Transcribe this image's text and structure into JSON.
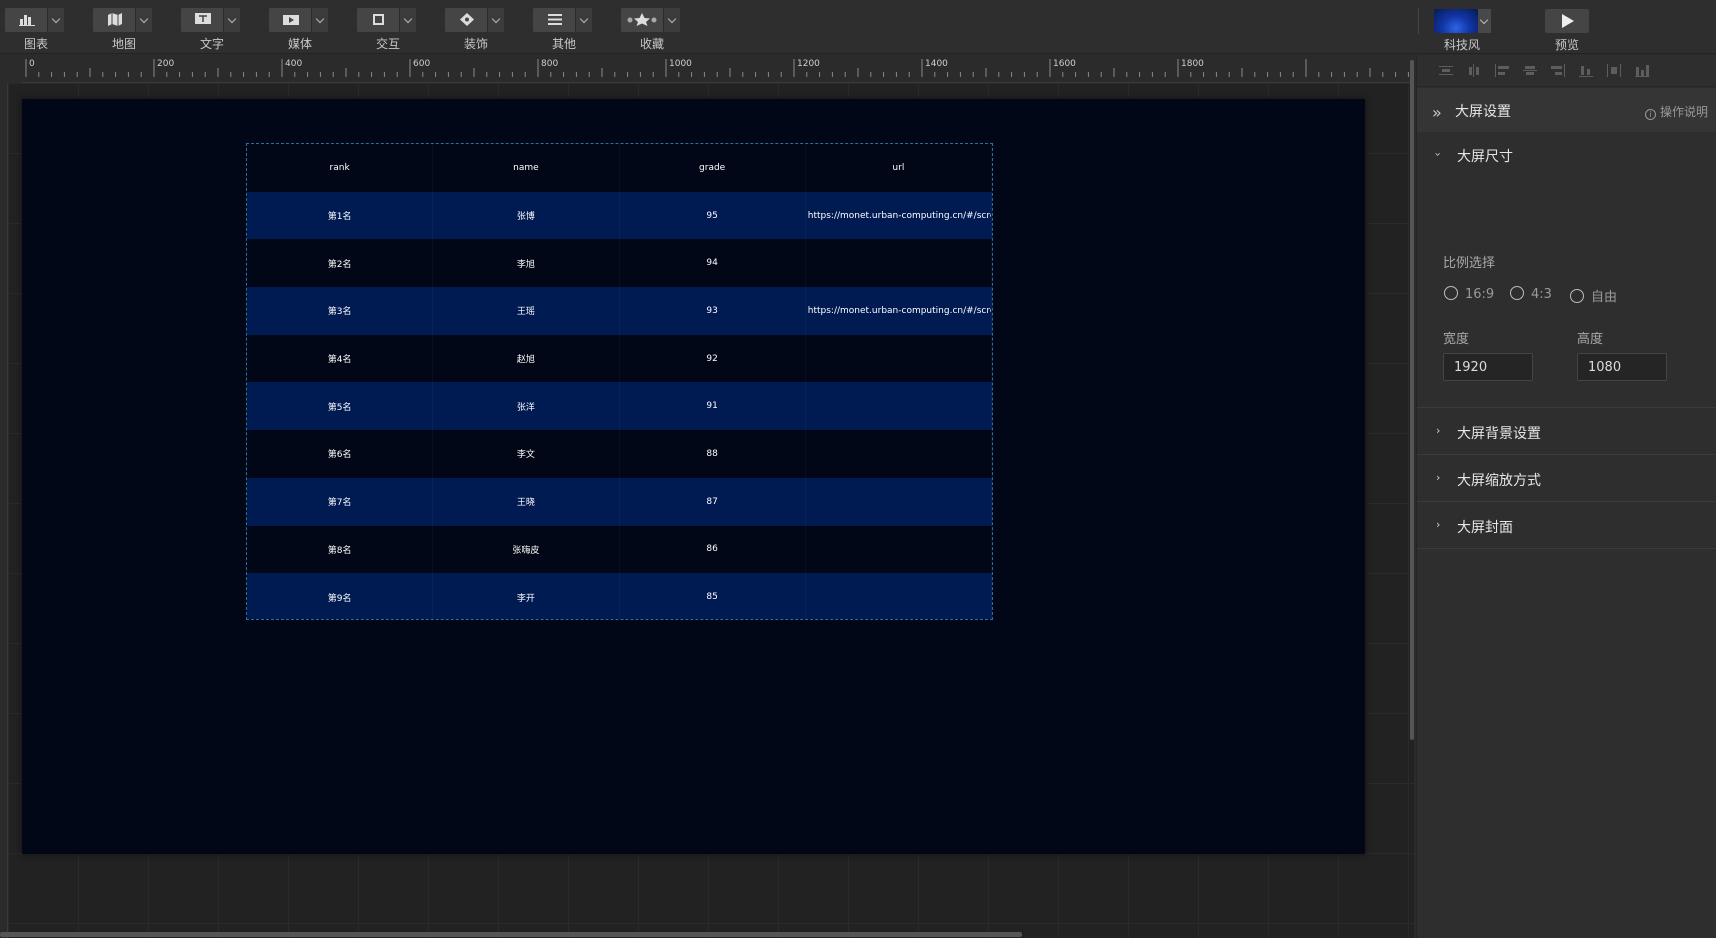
{
  "toolbar": {
    "tools": [
      {
        "label": "图表",
        "icon": "chart-icon"
      },
      {
        "label": "地图",
        "icon": "map-icon"
      },
      {
        "label": "文字",
        "icon": "text-icon"
      },
      {
        "label": "媒体",
        "icon": "media-icon"
      },
      {
        "label": "交互",
        "icon": "interaction-icon"
      },
      {
        "label": "装饰",
        "icon": "decoration-icon"
      },
      {
        "label": "其他",
        "icon": "other-icon"
      },
      {
        "label": "收藏",
        "icon": "favorites-icon"
      }
    ],
    "theme_label": "科技风",
    "preview_label": "预览"
  },
  "ruler": {
    "ticks": [
      "0",
      "200",
      "400",
      "600",
      "800",
      "1000",
      "1200",
      "1400",
      "1600",
      "1800"
    ]
  },
  "table": {
    "headers": [
      "rank",
      "name",
      "grade",
      "url"
    ],
    "rows": [
      [
        "第1名",
        "张博",
        "95",
        "https://monet.urban-computing.cn/#/screen?key="
      ],
      [
        "第2名",
        "李旭",
        "94",
        ""
      ],
      [
        "第3名",
        "王瑶",
        "93",
        "https://monet.urban-computing.cn/#/screen?key="
      ],
      [
        "第4名",
        "赵旭",
        "92",
        ""
      ],
      [
        "第5名",
        "张洋",
        "91",
        ""
      ],
      [
        "第6名",
        "李文",
        "88",
        ""
      ],
      [
        "第7名",
        "王晓",
        "87",
        ""
      ],
      [
        "第8名",
        "张嗨皮",
        "86",
        ""
      ],
      [
        "第9名",
        "李开",
        "85",
        ""
      ]
    ],
    "row_color_alt": "#001a52",
    "row_color": "#010716"
  },
  "panel": {
    "title": "大屏设置",
    "help_label": "操作说明",
    "size_section": {
      "title": "大屏尺寸",
      "ratio_label": "比例选择",
      "ratios": [
        "16:9",
        "4:3",
        "自由"
      ],
      "width_label": "宽度",
      "height_label": "高度",
      "width_value": "1920",
      "height_value": "1080"
    },
    "sections": [
      "大屏背景设置",
      "大屏缩放方式",
      "大屏封面"
    ]
  }
}
